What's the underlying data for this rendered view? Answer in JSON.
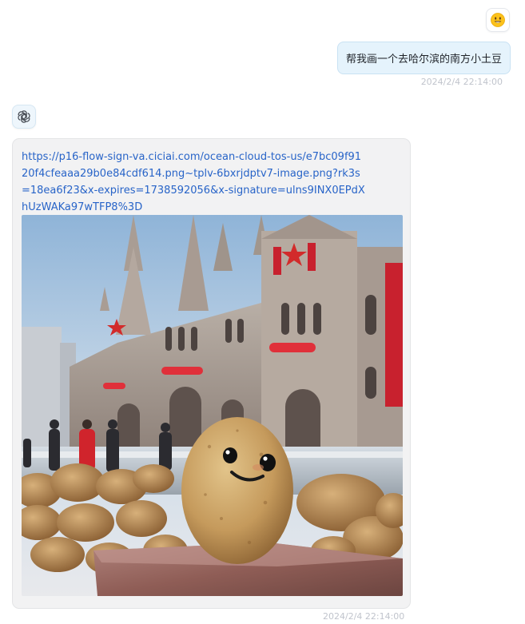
{
  "user": {
    "avatar_icon": "smiley-face-icon",
    "message": "帮我画一个去哈尔滨的南方小土豆",
    "timestamp": "2024/2/4 22:14:00"
  },
  "assistant": {
    "avatar_icon": "openai-logo-icon",
    "link_text": "https://p16-flow-sign-va.ciciai.com/ocean-cloud-tos-us/e7bc09f9120f4cfeaaa29b0e84cdf614.png~tplv-6bxrjdptv7-image.png?rk3s=18ea6f23&x-expires=1738592056&x-signature=ulns9INX0EPdXhUzWAKa97wTFP8%3D",
    "image_icon": "generated-image-potato-harbin",
    "timestamp": "2024/2/4 22:14:00"
  },
  "colors": {
    "user_bubble": "#e5f3fc",
    "assistant_card": "#f2f2f3",
    "link": "#2864c8",
    "timestamp": "#c0c4cc"
  }
}
